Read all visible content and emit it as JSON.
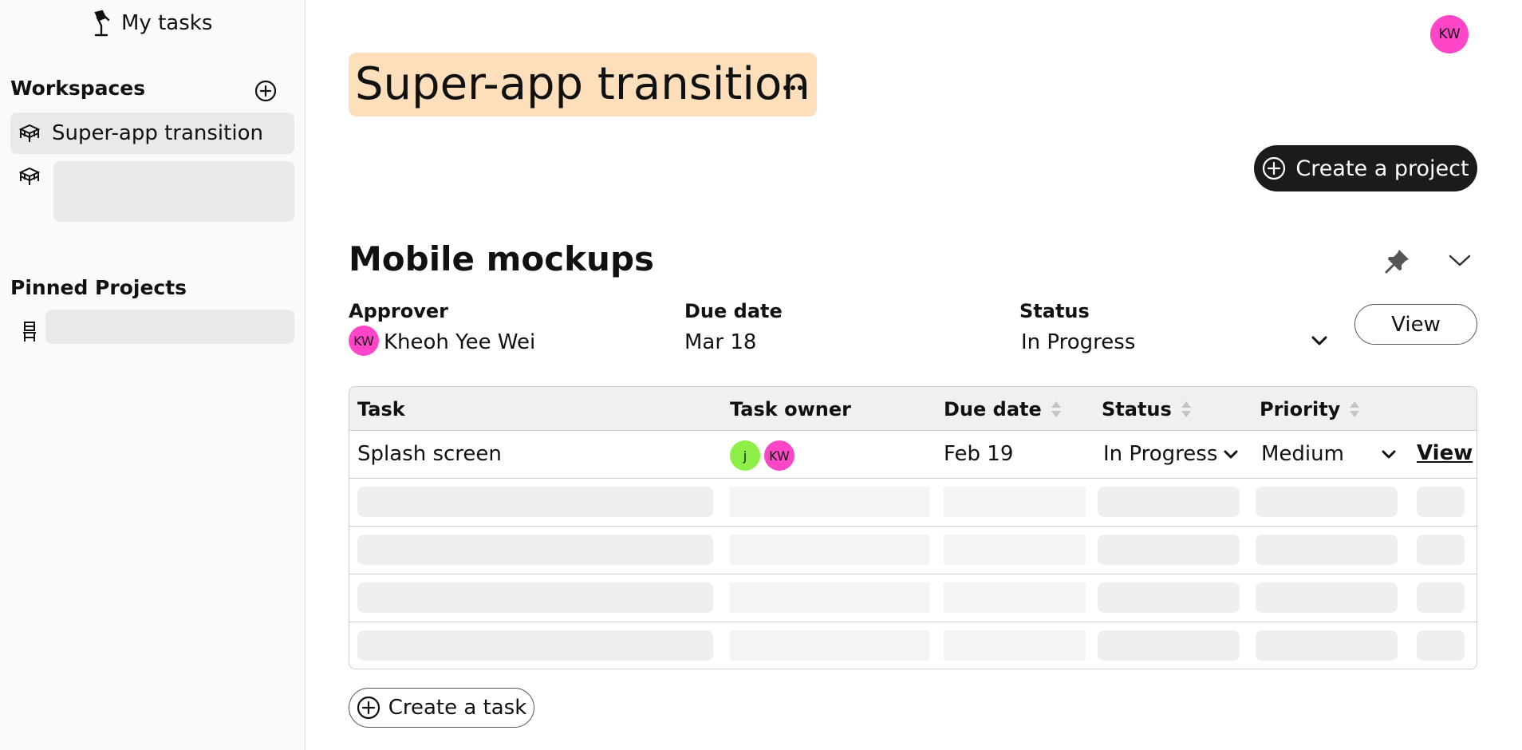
{
  "sidebar": {
    "my_tasks_label": "My tasks",
    "my_tasks_icon": "desk-lamp-icon",
    "workspaces_heading": "Workspaces",
    "add_workspace_icon": "plus-circle-icon",
    "workspaces": [
      {
        "label": "Super-app transition",
        "icon": "desk-icon",
        "selected": true
      },
      {
        "label": "",
        "icon": "desk-icon",
        "loading": true
      }
    ],
    "pinned_heading": "Pinned Projects",
    "pinned": [
      {
        "label": "",
        "icon": "chair-icon",
        "loading": true
      }
    ]
  },
  "header": {
    "user_initials": "KW",
    "workspace_title": "Super-app transition",
    "more_icon": "ellipsis-icon",
    "create_project_label": "Create a project"
  },
  "project": {
    "title": "Mobile mockups",
    "approver_label": "Approver",
    "approver_initials": "KW",
    "approver_name": "Kheoh Yee Wei",
    "due_date_label": "Due date",
    "due_date": "Mar 18",
    "status_label": "Status",
    "status": "In Progress",
    "view_label": "View",
    "pin_icon": "pin-icon",
    "collapse_icon": "chevron-down-icon"
  },
  "table": {
    "columns": [
      "Task",
      "Task owner",
      "Due date",
      "Status",
      "Priority"
    ],
    "rows": [
      {
        "task": "Splash screen",
        "owners": [
          "j",
          "KW"
        ],
        "due_date": "Feb 19",
        "status": "In Progress",
        "priority": "Medium",
        "action": "View"
      }
    ],
    "loading_rows": 4
  },
  "create_task_label": "Create a task",
  "colors": {
    "accent_pink": "#ff45c8",
    "accent_green": "#8eef48",
    "title_highlight": "#fde0bb",
    "dark_button": "#1b1b1b"
  }
}
